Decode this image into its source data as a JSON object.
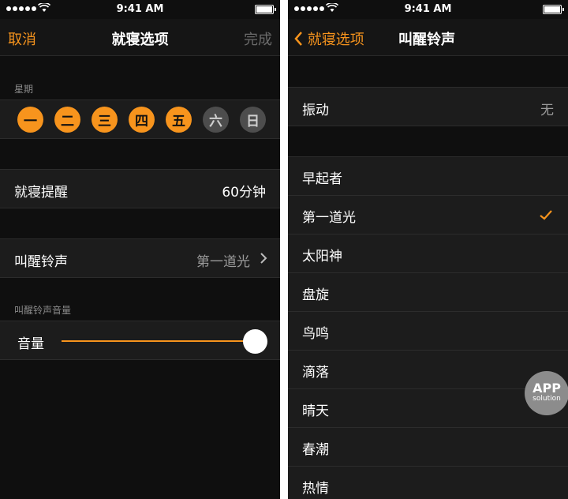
{
  "status": {
    "time": "9:41 AM"
  },
  "left": {
    "nav": {
      "cancel": "取消",
      "title": "就寝选项",
      "done": "完成"
    },
    "weekday_label": "星期",
    "days": [
      {
        "label": "一",
        "selected": true
      },
      {
        "label": "二",
        "selected": true
      },
      {
        "label": "三",
        "selected": true
      },
      {
        "label": "四",
        "selected": true
      },
      {
        "label": "五",
        "selected": true
      },
      {
        "label": "六",
        "selected": false
      },
      {
        "label": "日",
        "selected": false
      }
    ],
    "bedtime_reminder": {
      "label": "就寝提醒",
      "value": "60分钟"
    },
    "wake_sound": {
      "label": "叫醒铃声",
      "value": "第一道光"
    },
    "volume_section_label": "叫醒铃声音量",
    "volume": {
      "label": "音量",
      "level": 1.0
    }
  },
  "right": {
    "nav": {
      "back": "就寝选项",
      "title": "叫醒铃声"
    },
    "vibration": {
      "label": "振动",
      "value": "无"
    },
    "sounds": [
      "早起者",
      "第一道光",
      "太阳神",
      "盘旋",
      "鸟鸣",
      "滴落",
      "晴天",
      "春潮",
      "热情"
    ],
    "selected_sound": "第一道光"
  },
  "watermark": {
    "line1": "APP",
    "line2": "solution"
  },
  "colors": {
    "accent": "#f7941d",
    "background": "#0f0f0f",
    "cell": "#1c1c1c"
  }
}
